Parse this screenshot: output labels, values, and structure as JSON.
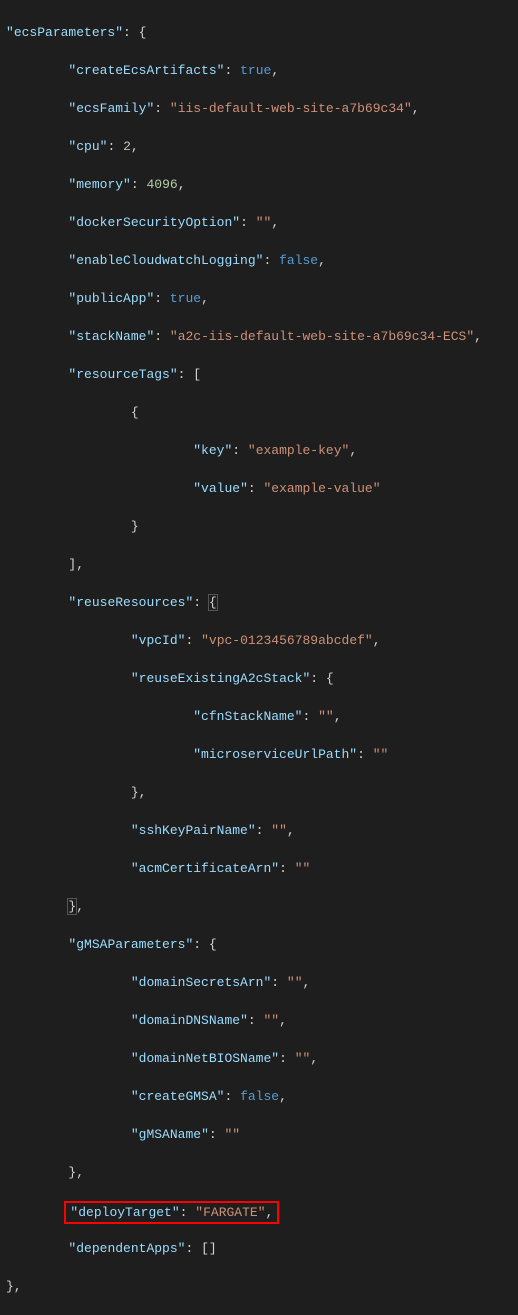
{
  "code": {
    "ecsParameters": "ecsParameters",
    "createEcsArtifacts_key": "createEcsArtifacts",
    "createEcsArtifacts_val": "true",
    "ecsFamily_key": "ecsFamily",
    "ecsFamily_val": "iis-default-web-site-a7b69c34",
    "cpu_key": "cpu",
    "cpu_val": "2",
    "memory_key": "memory",
    "memory_val": "4096",
    "dockerSecurityOption_key": "dockerSecurityOption",
    "dockerSecurityOption_val": "",
    "enableCloudwatchLogging_key": "enableCloudwatchLogging",
    "enableCloudwatchLogging_val": "false",
    "publicApp_key": "publicApp",
    "publicApp_val": "true",
    "stackName_key": "stackName",
    "stackName_val": "a2c-iis-default-web-site-a7b69c34-ECS",
    "resourceTags_key": "resourceTags",
    "rt_key_key": "key",
    "rt_key_val": "example-key",
    "rt_value_key": "value",
    "rt_value_val": "example-value",
    "reuseResources_key": "reuseResources",
    "vpcId_key": "vpcId",
    "vpcId_val": "vpc-0123456789abcdef",
    "reuseExistingA2cStack_key": "reuseExistingA2cStack",
    "cfnStackName_key": "cfnStackName",
    "cfnStackName_val": "",
    "microserviceUrlPath_key": "microserviceUrlPath",
    "microserviceUrlPath_val": "",
    "sshKeyPairName_key": "sshKeyPairName",
    "sshKeyPairName_val": "",
    "acmCertificateArn_key": "acmCertificateArn",
    "acmCertificateArn_val": "",
    "gMSAParameters_key": "gMSAParameters",
    "domainSecretsArn_key": "domainSecretsArn",
    "domainSecretsArn_val": "",
    "domainDNSName_key": "domainDNSName",
    "domainDNSName_val": "",
    "domainNetBIOSName_key": "domainNetBIOSName",
    "domainNetBIOSName_val": "",
    "createGMSA_key": "createGMSA",
    "createGMSA_val": "false",
    "gMSAName_key": "gMSAName",
    "gMSAName_val": "",
    "deployTarget_key": "deployTarget",
    "deployTarget_val": "FARGATE",
    "dependentApps_key": "dependentApps"
  }
}
